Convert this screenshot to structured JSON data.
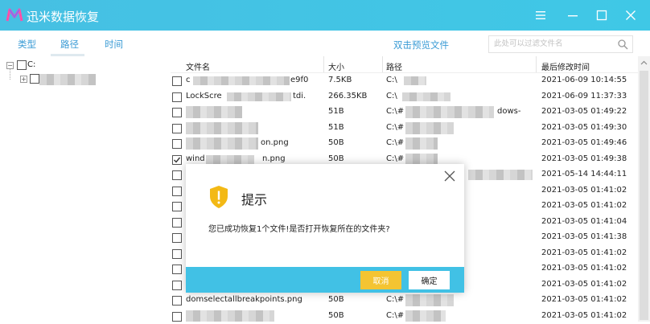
{
  "app": {
    "title": "迅米数据恢复"
  },
  "toolbar": {
    "tabs": [
      {
        "label": "类型"
      },
      {
        "label": "路径"
      },
      {
        "label": "时间"
      }
    ],
    "preview_hint": "双击预览文件",
    "search_placeholder": "此处可以过滤文件名"
  },
  "tree": {
    "root_label": "C:"
  },
  "columns": {
    "name": "文件名",
    "size": "大小",
    "path": "路径",
    "modified": "最后修改时间"
  },
  "rows": [
    {
      "name": "c",
      "name_tail": "e9f0",
      "size": "7.5KB",
      "path": "C:\\",
      "path_tail": "",
      "date": "2021-06-09 10:14:55",
      "checked": false
    },
    {
      "name": "LockScre",
      "name_tail": "tdi.",
      "size": "266.35KB",
      "path": "C:\\",
      "path_tail": "",
      "date": "2021-06-09 11:37:33",
      "checked": false
    },
    {
      "name": "",
      "name_tail": "",
      "size": "51B",
      "path": "C:\\#",
      "path_tail": "dows-",
      "date": "2021-03-05 01:49:22",
      "checked": false
    },
    {
      "name": "",
      "name_tail": "",
      "size": "51B",
      "path": "C:\\#",
      "path_tail": "",
      "date": "2021-03-05 01:49:30",
      "checked": false
    },
    {
      "name": "",
      "name_tail": "on.png",
      "size": "50B",
      "path": "C:\\#",
      "path_tail": "",
      "date": "2021-03-05 01:49:46",
      "checked": false
    },
    {
      "name": "wind",
      "name_tail": "n.png",
      "size": "50B",
      "path": "C:\\#",
      "path_tail": "",
      "date": "2021-03-05 01:49:38",
      "checked": true
    },
    {
      "name": "",
      "name_tail": "",
      "size": "",
      "path": "",
      "path_tail": "",
      "date": "2021-05-14 14:44:11",
      "checked": false
    },
    {
      "name": "",
      "name_tail": "",
      "size": "",
      "path": "",
      "path_tail": "",
      "date": "2021-03-05 01:41:02",
      "checked": false
    },
    {
      "name": "",
      "name_tail": "",
      "size": "",
      "path": "",
      "path_tail": "",
      "date": "2021-03-05 01:41:02",
      "checked": false
    },
    {
      "name": "",
      "name_tail": "",
      "size": "",
      "path": "",
      "path_tail": "",
      "date": "2021-03-05 01:41:04",
      "checked": false
    },
    {
      "name": "",
      "name_tail": "",
      "size": "",
      "path": "",
      "path_tail": "",
      "date": "2021-03-05 01:41:38",
      "checked": false
    },
    {
      "name": "",
      "name_tail": "",
      "size": "",
      "path": "",
      "path_tail": "",
      "date": "2021-03-05 01:41:02",
      "checked": false
    },
    {
      "name": "",
      "name_tail": "",
      "size": "",
      "path": "",
      "path_tail": "",
      "date": "2021-03-05 01:41:02",
      "checked": false
    },
    {
      "name": "",
      "name_tail": "",
      "size": "",
      "path": "",
      "path_tail": "",
      "date": "2021-03-05 01:41:02",
      "checked": false
    },
    {
      "name": "domselectallbreakpoints.png",
      "name_tail": "",
      "size": "50B",
      "path": "C:\\#",
      "path_tail": "",
      "date": "2021-03-05 01:41:02",
      "checked": false
    },
    {
      "name": "",
      "name_tail": "",
      "size": "50B",
      "path": "C:\\#",
      "path_tail": "",
      "date": "2021-03-05 01:41:02",
      "checked": false
    }
  ],
  "dialog": {
    "title": "提示",
    "message": "您已成功恢复1个文件!是否打开恢复所在的文件夹?",
    "cancel_label": "取消",
    "ok_label": "确定"
  },
  "colors": {
    "accent": "#41c1e5",
    "link": "#3a9bd5",
    "warning": "#f4c432"
  }
}
